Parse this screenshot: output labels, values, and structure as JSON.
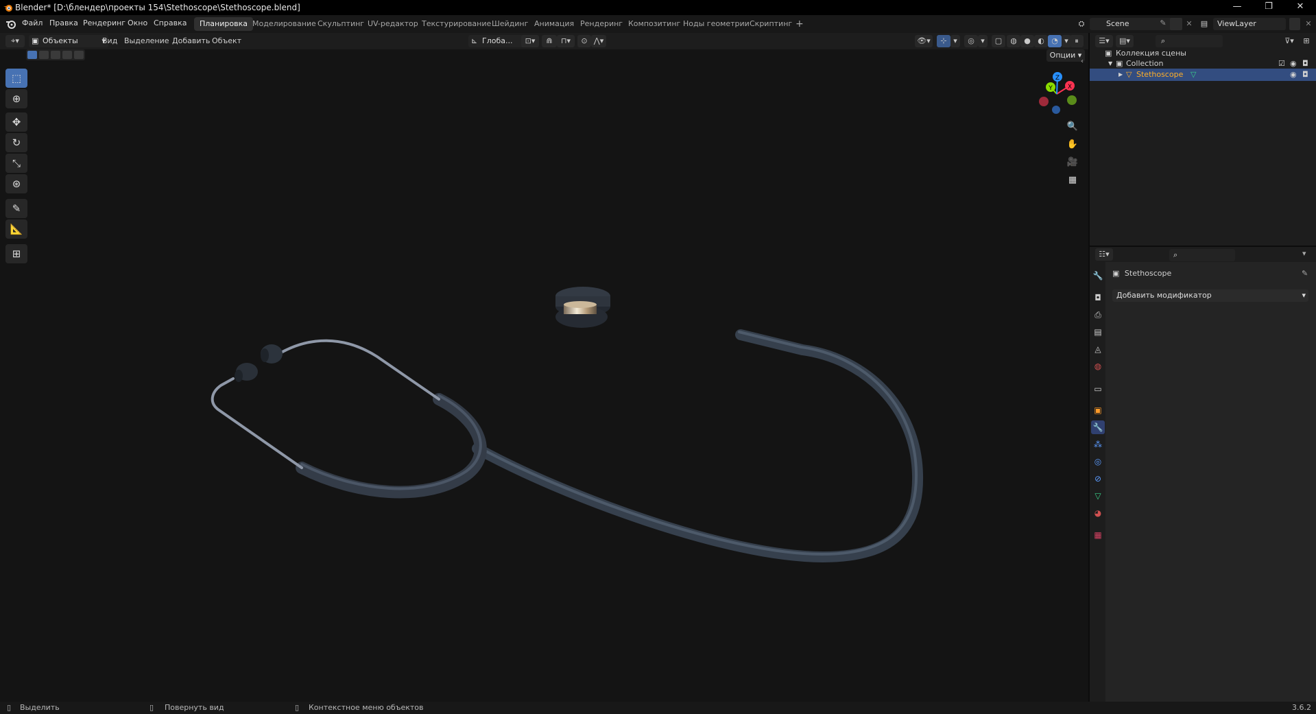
{
  "titlebar": {
    "title": "Blender* [D:\\блендер\\проекты 154\\Stethoscope\\Stethoscope.blend]",
    "minimize": "—",
    "maximize": "❐",
    "close": "✕"
  },
  "menu": {
    "items": [
      "Файл",
      "Правка",
      "Рендеринг",
      "Окно",
      "Справка"
    ]
  },
  "workspaces": {
    "tabs": [
      "Планировка",
      "Моделирование",
      "Скульптинг",
      "UV-редактор",
      "Текстурирование",
      "Шейдинг",
      "Анимация",
      "Рендеринг",
      "Композитинг",
      "Ноды геометрии",
      "Скриптинг"
    ],
    "active": "Планировка",
    "add": "+"
  },
  "scene": {
    "name": "Scene"
  },
  "viewlayer": {
    "name": "ViewLayer"
  },
  "viewport_header": {
    "mode": "Объекты",
    "menus": [
      "Вид",
      "Выделение",
      "Добавить",
      "Объект"
    ],
    "orientation": "Глоба...",
    "options": "Опции"
  },
  "gizmo": {
    "x": "X",
    "y": "Y",
    "z": "Z"
  },
  "outliner": {
    "root": "Коллекция сцены",
    "collection": "Collection",
    "object": "Stethoscope"
  },
  "properties": {
    "object_name": "Stethoscope",
    "add_modifier": "Добавить модификатор"
  },
  "statusbar": {
    "select": "Выделить",
    "rotate": "Повернуть вид",
    "context": "Контекстное меню объектов",
    "version": "3.6.2"
  },
  "colors": {
    "accent": "#4772b3",
    "selected_row": "#334d80",
    "object_label": "#ffaf29",
    "gizmo_x": "#ff3352",
    "gizmo_y": "#8bdc00",
    "gizmo_z": "#2890ff"
  }
}
